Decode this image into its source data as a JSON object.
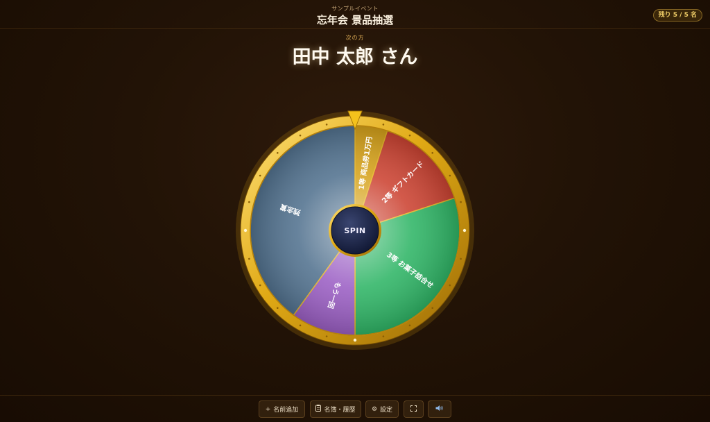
{
  "header": {
    "event_subtitle": "サンプルイベント",
    "event_title": "忘年会 景品抽選",
    "remaining_badge": "残り 5 / 5 名"
  },
  "next_up": {
    "label": "次の方",
    "name": "田中 太郎 さん"
  },
  "wheel": {
    "spin_label": "SPIN",
    "segments": [
      {
        "label": "1等 商品券1万円",
        "color": "#d6a21a",
        "weight": 5
      },
      {
        "label": "2等 ギフトカード",
        "color": "#cc4332",
        "weight": 15
      },
      {
        "label": "3等 お菓子詰合せ",
        "color": "#2fb566",
        "weight": 30
      },
      {
        "label": "もう一回",
        "color": "#9b5fc4",
        "weight": 10
      },
      {
        "label": "残念賞",
        "color": "#52728f",
        "weight": 40
      }
    ]
  },
  "toolbar": {
    "add_name": "名前追加",
    "roster_history": "名簿・履歴",
    "settings": "設定",
    "add_icon": "plus-icon",
    "roster_icon": "clipboard-icon",
    "settings_icon": "gear-icon",
    "fullscreen_icon": "fullscreen-icon",
    "sound_icon": "speaker-icon"
  }
}
